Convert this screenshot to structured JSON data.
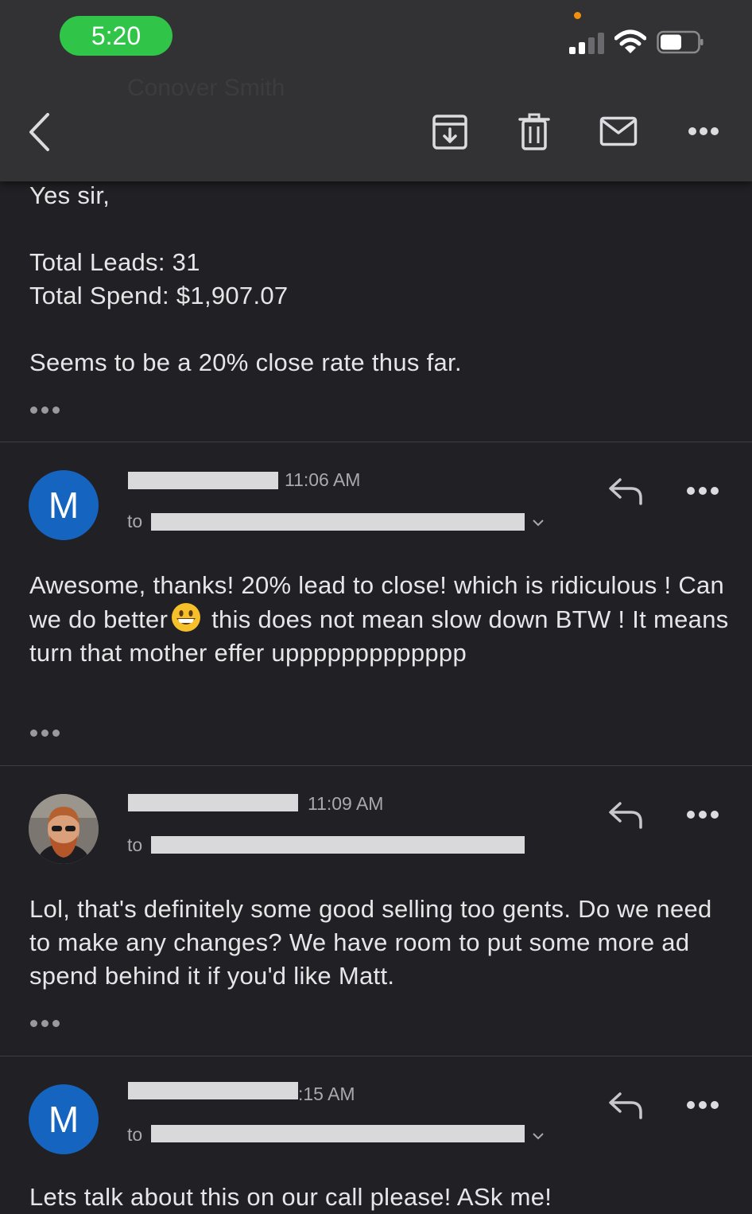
{
  "status": {
    "time": "5:20",
    "colors": {
      "pill": "#30c549",
      "dot": "#f0900c"
    }
  },
  "toolbar": {
    "faded_subject": "Conover Smith",
    "back_icon": "back-chevron-icon",
    "archive_icon": "archive-icon",
    "delete_icon": "trash-icon",
    "mark_unread_icon": "mail-icon",
    "more_icon": "more-dots-icon"
  },
  "quoted_message": {
    "greeting": "Yes sir,",
    "line1": "Total Leads: 31",
    "line2": "Total Spend: $1,907.07",
    "line3": "Seems to be a 20% close rate thus far."
  },
  "messages": [
    {
      "avatar_letter": "M",
      "time": "11:06 AM",
      "to_label": "to",
      "body_part1": "Awesome, thanks!  20% lead to close! which is ridiculous !  Can we do better",
      "body_part2": " this does not mean slow down BTW ! It means turn that mother effer uppppppppppppp"
    },
    {
      "time": "11:09 AM",
      "to_label": "to",
      "body": "Lol, that's definitely some good selling too gents. Do we need to make any changes? We have room to put some more ad spend behind it if you'd like Matt."
    },
    {
      "avatar_letter": "M",
      "time": ":15 AM",
      "to_label": "to",
      "body_partial": "Lets talk about this on our call please!  ASk me!"
    }
  ]
}
